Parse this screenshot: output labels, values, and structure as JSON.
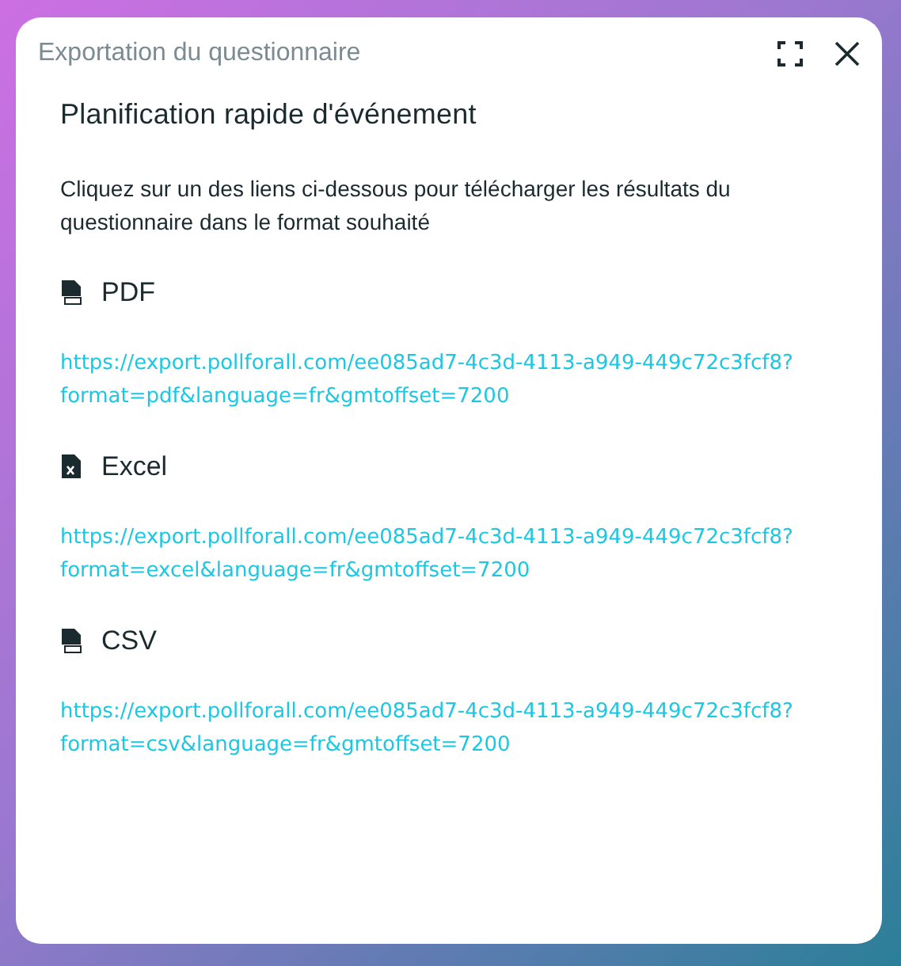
{
  "dialog": {
    "title": "Exportation du questionnaire",
    "heading": "Planification rapide d'événement",
    "instructions": "Cliquez sur un des liens ci-dessous pour télécharger les résultats du questionnaire dans le format souhaité"
  },
  "formats": [
    {
      "kind": "pdf",
      "label": "PDF",
      "link": "https://export.pollforall.com/ee085ad7-4c3d-4113-a949-449c72c3fcf8?format=pdf&language=fr&gmtoffset=7200"
    },
    {
      "kind": "excel",
      "label": "Excel",
      "link": "https://export.pollforall.com/ee085ad7-4c3d-4113-a949-449c72c3fcf8?format=excel&language=fr&gmtoffset=7200"
    },
    {
      "kind": "csv",
      "label": "CSV",
      "link": "https://export.pollforall.com/ee085ad7-4c3d-4113-a949-449c72c3fcf8?format=csv&language=fr&gmtoffset=7200"
    }
  ]
}
